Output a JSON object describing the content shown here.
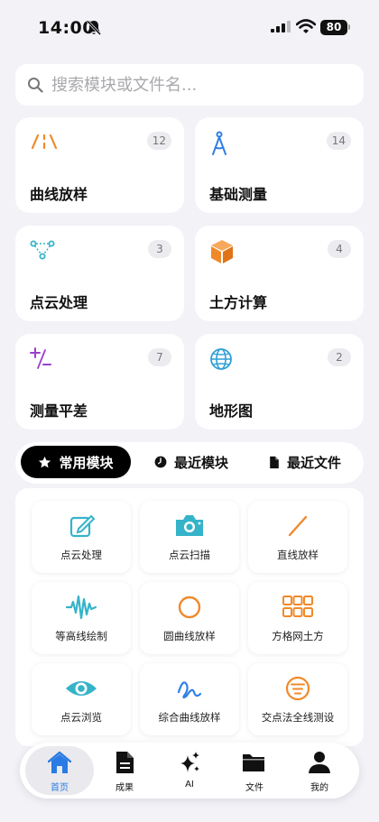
{
  "status_bar": {
    "time": "14:00",
    "battery": "80",
    "icons": [
      "bell-slash-icon",
      "signal-icon",
      "wifi-icon",
      "battery-icon"
    ]
  },
  "search": {
    "placeholder": "搜索模块或文件名...",
    "value": "",
    "icon": "search-icon"
  },
  "categories": [
    {
      "title": "曲线放样",
      "count": "12",
      "icon": "curve-stakeout-icon",
      "color": "#f0892a"
    },
    {
      "title": "基础测量",
      "count": "14",
      "icon": "compass-icon",
      "color": "#2f7fe6"
    },
    {
      "title": "点云处理",
      "count": "3",
      "icon": "point-cloud-icon",
      "color": "#35b3c9"
    },
    {
      "title": "土方计算",
      "count": "4",
      "icon": "cube-icon",
      "color": "#f0892a"
    },
    {
      "title": "测量平差",
      "count": "7",
      "icon": "plus-minus-icon",
      "color": "#9a3fd0"
    },
    {
      "title": "地形图",
      "count": "2",
      "icon": "globe-icon",
      "color": "#2f9fd6"
    }
  ],
  "tabs": [
    {
      "label": "常用模块",
      "icon": "star-icon",
      "active": true
    },
    {
      "label": "最近模块",
      "icon": "clock-icon",
      "active": false
    },
    {
      "label": "最近文件",
      "icon": "document-icon",
      "active": false
    }
  ],
  "modules": [
    {
      "label": "点云处理",
      "icon": "edit-icon",
      "color": "#35b3c9"
    },
    {
      "label": "点云扫描",
      "icon": "camera-icon",
      "color": "#35b3c9"
    },
    {
      "label": "直线放样",
      "icon": "line-icon",
      "color": "#f0892a"
    },
    {
      "label": "等高线绘制",
      "icon": "waveform-icon",
      "color": "#35b3c9"
    },
    {
      "label": "圆曲线放样",
      "icon": "circle-icon",
      "color": "#f0892a"
    },
    {
      "label": "方格网土方",
      "icon": "grid-icon",
      "color": "#f0892a"
    },
    {
      "label": "点云浏览",
      "icon": "eye-icon",
      "color": "#35b3c9"
    },
    {
      "label": "综合曲线放样",
      "icon": "scribble-icon",
      "color": "#2f7fe6"
    },
    {
      "label": "交点法全线测设",
      "icon": "list-circle-icon",
      "color": "#f0892a"
    }
  ],
  "nav": [
    {
      "label": "首页",
      "icon": "home-icon",
      "active": true
    },
    {
      "label": "成果",
      "icon": "document-icon",
      "active": false
    },
    {
      "label": "AI",
      "icon": "sparkles-icon",
      "active": false
    },
    {
      "label": "文件",
      "icon": "folder-icon",
      "active": false
    },
    {
      "label": "我的",
      "icon": "person-icon",
      "active": false
    }
  ],
  "colors": {
    "background": "#f2f2f7",
    "accent": "#2a7be4",
    "active_tab": "#000000"
  }
}
